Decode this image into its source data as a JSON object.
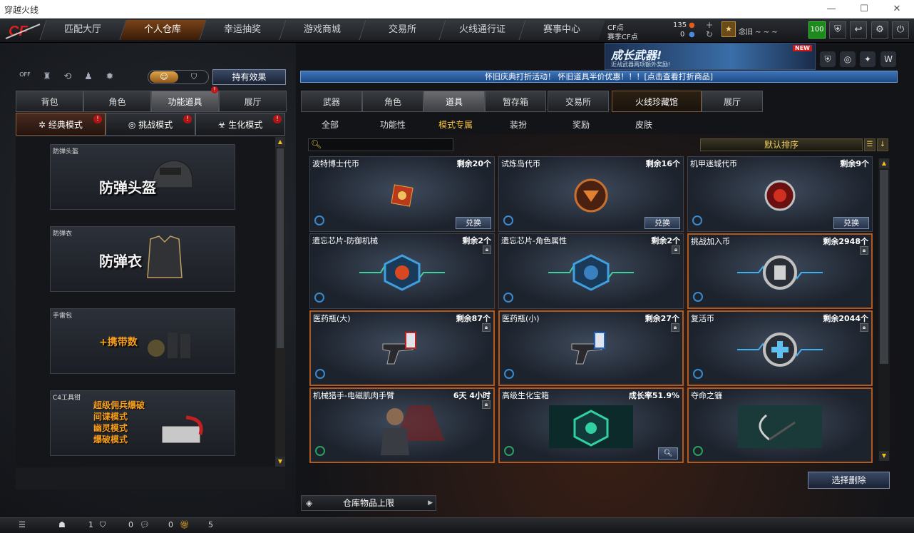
{
  "window": {
    "title": "穿越火线"
  },
  "nav": {
    "tabs": [
      {
        "label": "匹配大厅"
      },
      {
        "label": "个人仓库"
      },
      {
        "label": "幸运抽奖"
      },
      {
        "label": "游戏商城"
      },
      {
        "label": "交易所"
      },
      {
        "label": "火线通行证"
      },
      {
        "label": "赛事中心"
      }
    ],
    "active_tab": "个人仓库",
    "cf_label": "CF点",
    "cf_value": "135",
    "match_cf_label": "赛季CF点",
    "match_cf_value": "0",
    "username": "念旧 ~ ~ ~",
    "level": "100"
  },
  "banner": {
    "headline": "成长武器!",
    "sub": "近战武器两项额外奖励!",
    "badge": "NEW"
  },
  "notice": "怀旧庆典打折活动！ 怀旧道具半价优惠！！！[点击查看打折商品]",
  "left": {
    "effect_button": "持有效果",
    "toggle_off": "OFF",
    "tabs": [
      {
        "label": "背包"
      },
      {
        "label": "角色"
      },
      {
        "label": "功能道具"
      },
      {
        "label": "展厅"
      }
    ],
    "active_tab": "功能道具",
    "modes": [
      {
        "label": "经典模式"
      },
      {
        "label": "挑战模式"
      },
      {
        "label": "生化模式"
      }
    ],
    "cards": [
      {
        "caption": "防弹头盔",
        "title": "防弹头盔"
      },
      {
        "caption": "防弹衣",
        "title": "防弹衣"
      },
      {
        "caption": "手雷包",
        "title": "+携带数"
      },
      {
        "caption": "C4工具钳",
        "lines": [
          "超级佣兵爆破",
          "间谍模式",
          "幽灵模式",
          "爆破模式"
        ]
      }
    ]
  },
  "right": {
    "tabs": [
      {
        "label": "武器"
      },
      {
        "label": "角色"
      },
      {
        "label": "道具"
      },
      {
        "label": "暂存箱"
      },
      {
        "label": "交易所"
      },
      {
        "label": "火线珍藏馆"
      },
      {
        "label": "展厅"
      }
    ],
    "active_tab": "道具",
    "subtabs": [
      {
        "label": "全部"
      },
      {
        "label": "功能性"
      },
      {
        "label": "模式专属"
      },
      {
        "label": "装扮"
      },
      {
        "label": "奖励"
      },
      {
        "label": "皮肤"
      }
    ],
    "active_subtab": "模式专属",
    "sort_label": "默认排序",
    "items": [
      {
        "name": "波特博士代币",
        "remain": "剩余20个",
        "action": "兑换"
      },
      {
        "name": "试炼岛代币",
        "remain": "剩余16个",
        "action": "兑换"
      },
      {
        "name": "机甲迷城代币",
        "remain": "剩余9个",
        "action": "兑换"
      },
      {
        "name": "遗忘芯片-防御机械",
        "remain": "剩余2个"
      },
      {
        "name": "遗忘芯片-角色属性",
        "remain": "剩余2个"
      },
      {
        "name": "挑战加入币",
        "remain": "剩余2948个"
      },
      {
        "name": "医药瓶(大)",
        "remain": "剩余87个"
      },
      {
        "name": "医药瓶(小)",
        "remain": "剩余27个"
      },
      {
        "name": "复活币",
        "remain": "剩余2044个"
      },
      {
        "name": "机械猎手-电磁肌肉手臂",
        "remain": "6天 4小时"
      },
      {
        "name": "高级生化宝箱",
        "remain": "成长率51.9%"
      },
      {
        "name": "夺命之镰",
        "remain": ""
      }
    ],
    "delete_button": "选择删除",
    "warehouse_button": "仓库物品上限"
  },
  "bottom": {
    "count1": "1",
    "count2": "0",
    "count3": "0",
    "count4": "5"
  }
}
